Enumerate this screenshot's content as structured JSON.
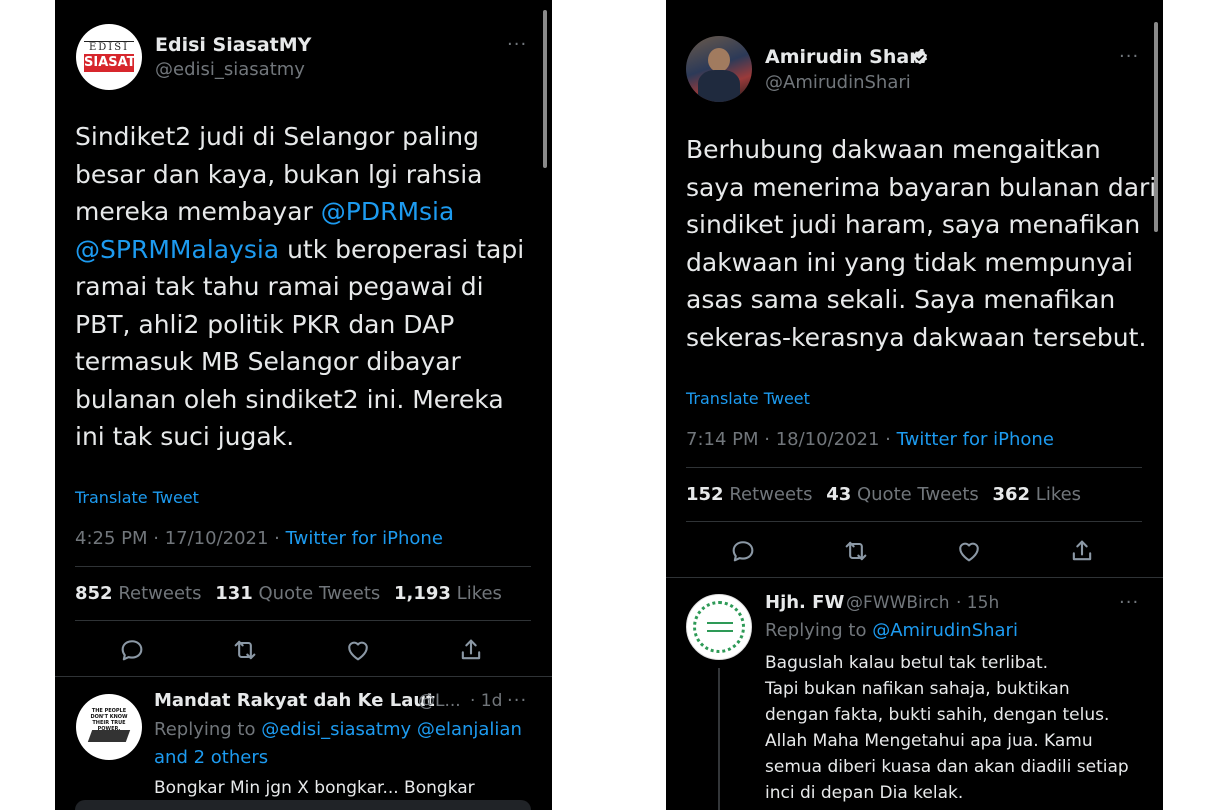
{
  "left": {
    "author": {
      "name": "Edisi SiasatMY",
      "handle": "@edisi_siasatmy",
      "logo_top": "EDISI",
      "logo_bottom": "SIASAT"
    },
    "more": "···",
    "tweet_lines": [
      [
        {
          "t": "Sindiket2 judi di Selangor paling"
        }
      ],
      [
        {
          "t": "besar dan kaya, bukan lgi rahsia"
        }
      ],
      [
        {
          "t": "mereka membayar "
        },
        {
          "t": "@PDRMsia",
          "link": true
        }
      ],
      [
        {
          "t": "@SPRMMalaysia",
          "link": true
        },
        {
          "t": " utk beroperasi tapi"
        }
      ],
      [
        {
          "t": "ramai tak tahu ramai pegawai di"
        }
      ],
      [
        {
          "t": "PBT, ahli2 politik PKR dan DAP"
        }
      ],
      [
        {
          "t": "termasuk MB Selangor dibayar"
        }
      ],
      [
        {
          "t": "bulanan oleh sindiket2 ini. Mereka"
        }
      ],
      [
        {
          "t": "ini tak suci jugak."
        }
      ]
    ],
    "translate": "Translate Tweet",
    "time": "4:25 PM · 17/10/2021 · ",
    "source": "Twitter for iPhone",
    "stats": {
      "retweets": "852",
      "retweets_label": "Retweets",
      "quotes": "131",
      "quotes_label": "Quote Tweets",
      "likes": "1,193",
      "likes_label": "Likes"
    },
    "reply": {
      "name": "Mandat Rakyat dah Ke Laut",
      "handle": "@L...",
      "age": "· 1d",
      "avatar_text": "THE PEOPLE DON'T KNOW THEIR TRUE POWER.",
      "replying_prefix": "Replying to ",
      "replying_to": "@edisi_siasatmy @elanjalian",
      "replying_to_2": "and 2 others",
      "text": "Bongkar Min jgn X bongkar... Bongkar"
    }
  },
  "right": {
    "author": {
      "name": "Amirudin Shari",
      "handle": "@AmirudinShari",
      "verified": true
    },
    "more": "···",
    "tweet_lines": [
      "Berhubung dakwaan mengaitkan",
      "saya menerima bayaran bulanan dari",
      "sindiket judi haram, saya menafikan",
      "dakwaan ini yang tidak mempunyai",
      "asas sama sekali. Saya menafikan",
      "sekeras-kerasnya dakwaan tersebut."
    ],
    "translate": "Translate Tweet",
    "time": "7:14 PM · 18/10/2021 · ",
    "source": "Twitter for iPhone",
    "stats": {
      "retweets": "152",
      "retweets_label": "Retweets",
      "quotes": "43",
      "quotes_label": "Quote Tweets",
      "likes": "362",
      "likes_label": "Likes"
    },
    "reply": {
      "name": "Hjh. FW",
      "handle": "@FWWBirch",
      "age": "· 15h",
      "replying_prefix": "Replying to ",
      "replying_to": "@AmirudinShari",
      "text_lines": [
        "Baguslah kalau betul tak terlibat.",
        "Tapi bukan nafikan sahaja, buktikan",
        "dengan fakta, bukti sahih, dengan telus.",
        "Allah Maha Mengetahui apa jua. Kamu",
        "semua diberi kuasa dan akan diadili setiap",
        "inci di depan Dia kelak."
      ]
    }
  },
  "colors": {
    "background": "#000000",
    "text": "#e7e9ea",
    "muted": "#71767b",
    "link": "#1d9bf0",
    "divider": "#2f3336",
    "logo_red": "#d7262c",
    "verified": "#e7e9ea"
  },
  "icons": [
    "reply-icon",
    "retweet-icon",
    "like-icon",
    "share-icon",
    "verified-icon",
    "more-icon"
  ]
}
